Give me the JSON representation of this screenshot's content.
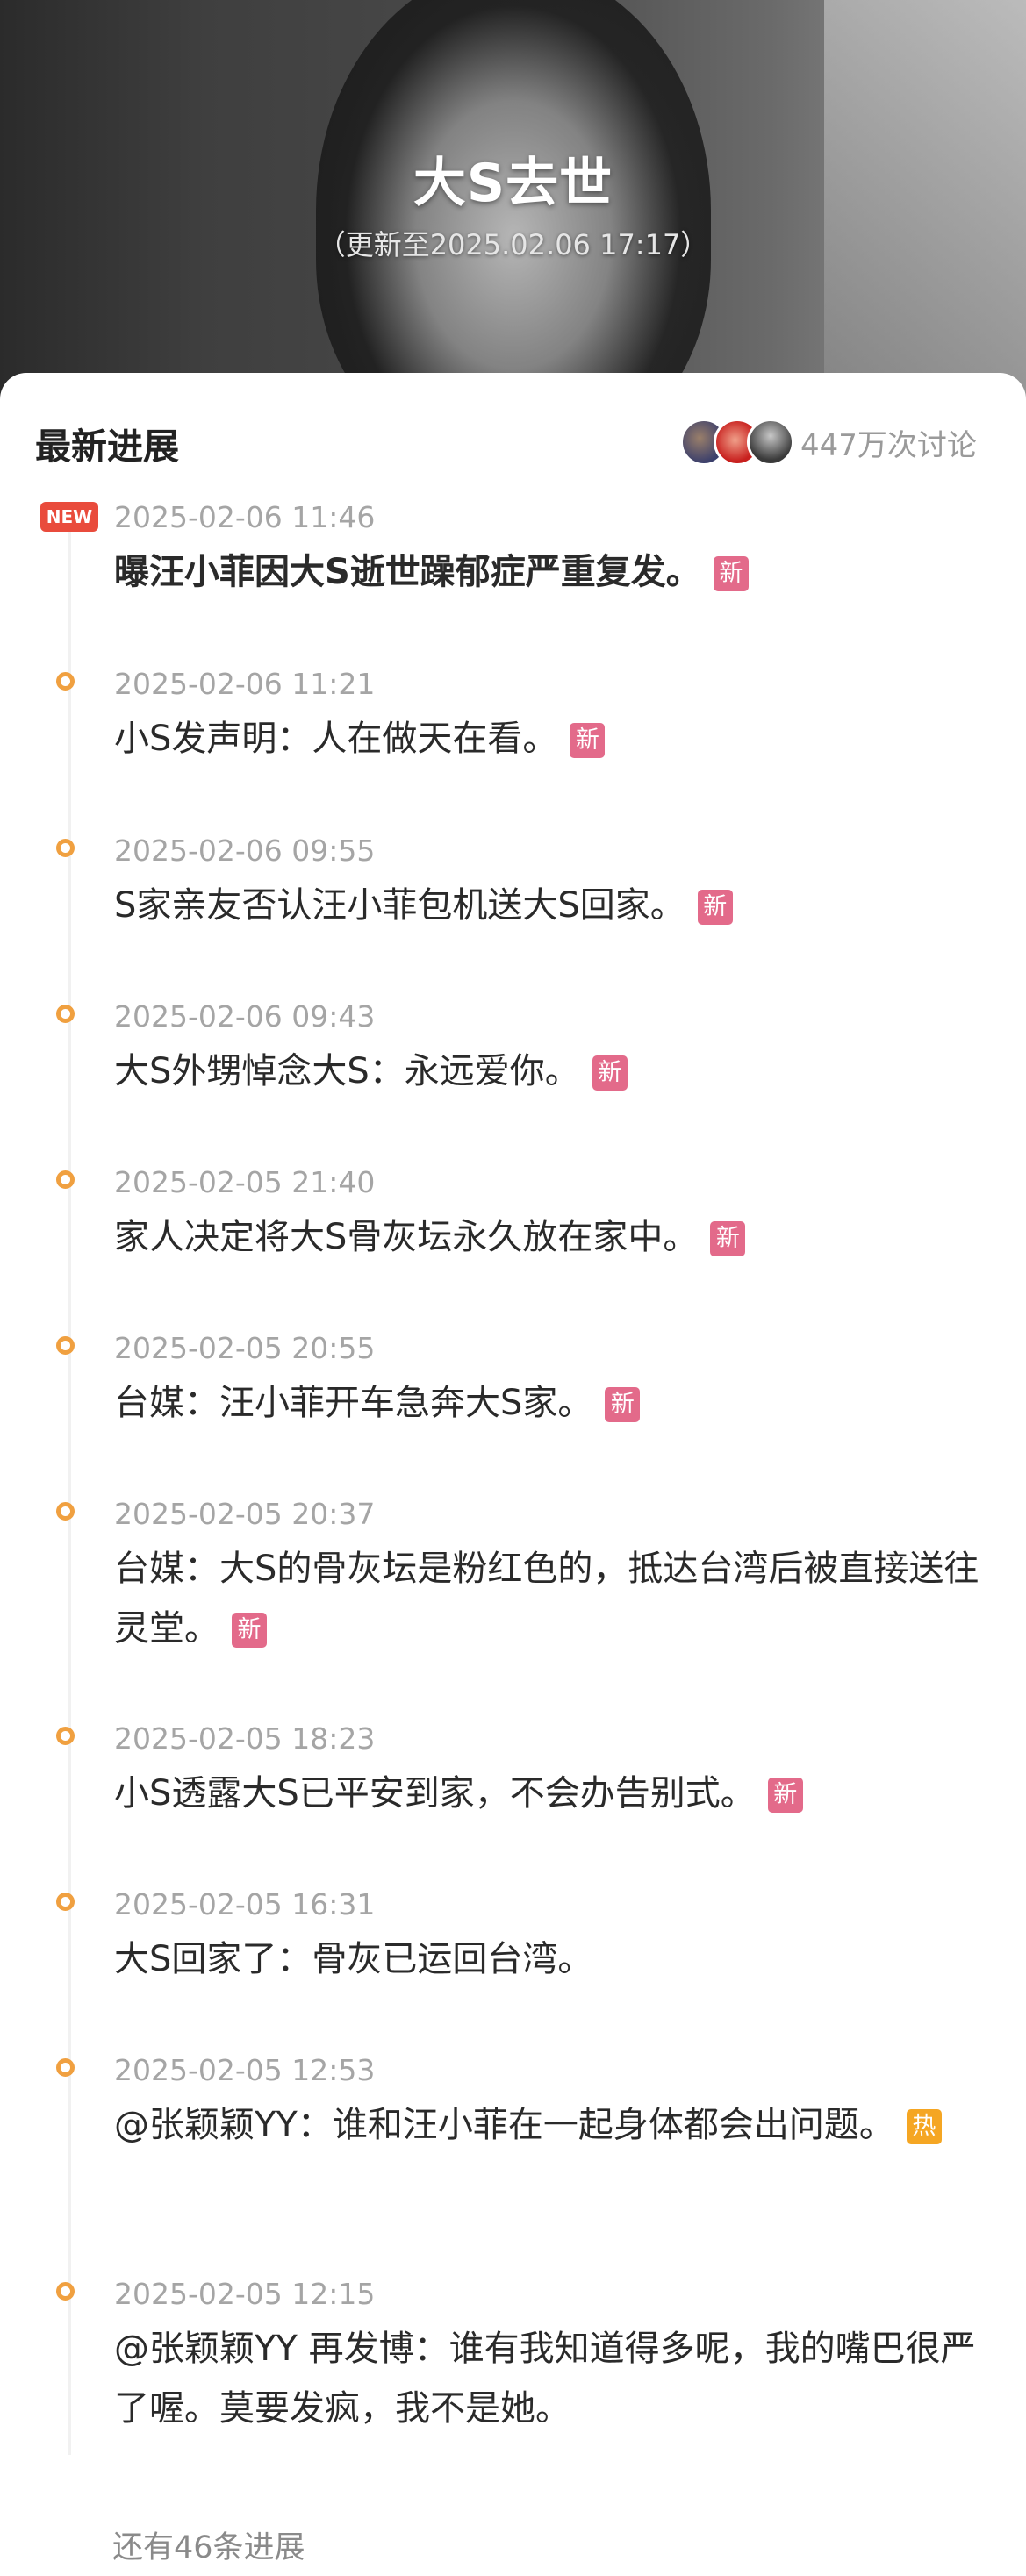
{
  "header": {
    "title": "大S去世",
    "subtitle": "（更新至2025.02.06 17:17）"
  },
  "card": {
    "title": "最新进展",
    "discussion_count": "447万次讨论",
    "new_badge": "NEW",
    "more_text": "还有46条进展"
  },
  "colors": {
    "tag_new": "#e36a8a",
    "tag_hot": "#f5a623",
    "timeline_dot": "#f0a040",
    "new_badge": "#e94b3c"
  },
  "timeline": [
    {
      "time": "2025-02-06 11:46",
      "text": "曝汪小菲因大S逝世躁郁症严重复发。",
      "tag": "新",
      "tag_type": "new"
    },
    {
      "time": "2025-02-06 11:21",
      "text": "小S发声明：人在做天在看。",
      "tag": "新",
      "tag_type": "new"
    },
    {
      "time": "2025-02-06 09:55",
      "text": "S家亲友否认汪小菲包机送大S回家。",
      "tag": "新",
      "tag_type": "new"
    },
    {
      "time": "2025-02-06 09:43",
      "text": "大S外甥悼念大S：永远爱你。",
      "tag": "新",
      "tag_type": "new"
    },
    {
      "time": "2025-02-05 21:40",
      "text": "家人决定将大S骨灰坛永久放在家中。",
      "tag": "新",
      "tag_type": "new"
    },
    {
      "time": "2025-02-05 20:55",
      "text": "台媒：汪小菲开车急奔大S家。",
      "tag": "新",
      "tag_type": "new"
    },
    {
      "time": "2025-02-05 20:37",
      "text": "台媒：大S的骨灰坛是粉红色的，抵达台湾后被直接送往灵堂。",
      "tag": "新",
      "tag_type": "new"
    },
    {
      "time": "2025-02-05 18:23",
      "text": "小S透露大S已平安到家，不会办告别式。",
      "tag": "新",
      "tag_type": "new"
    },
    {
      "time": "2025-02-05 16:31",
      "text": "大S回家了：骨灰已运回台湾。",
      "tag": "",
      "tag_type": ""
    },
    {
      "time": "2025-02-05 12:53",
      "text": "@张颖颖YY：谁和汪小菲在一起身体都会出问题。",
      "tag": "热",
      "tag_type": "hot"
    },
    {
      "time": "2025-02-05 12:15",
      "text": "@张颖颖YY 再发博：谁有我知道得多呢，我的嘴巴很严了喔。莫要发疯，我不是她。",
      "tag": "",
      "tag_type": ""
    }
  ]
}
